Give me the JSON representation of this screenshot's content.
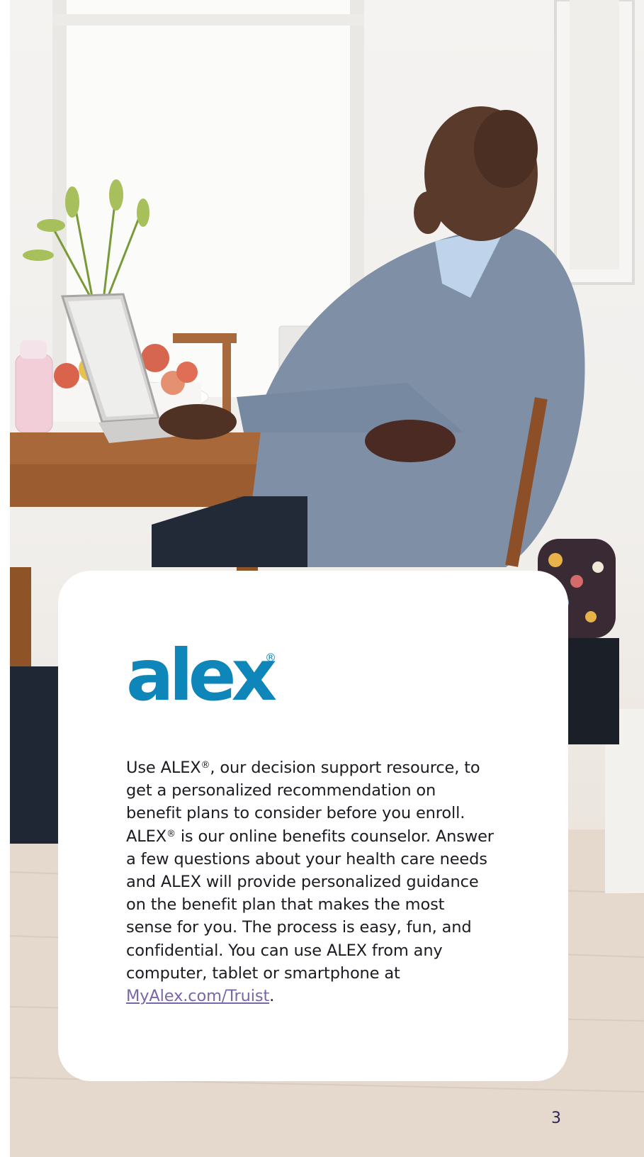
{
  "brand": {
    "logo_text": "alex",
    "logo_mark": "®",
    "logo_color": "#0f86b9"
  },
  "photo": {
    "icon": "man-at-laptop-photo"
  },
  "card": {
    "paragraph": {
      "part1": "Use ALEX",
      "reg1": "®",
      "part2": ", our decision support resource, to get a personalized recommendation on benefit plans to consider before you enroll. ALEX",
      "reg2": "®",
      "part3": " is our online benefits counselor. Answer a few questions about your health care needs and ALEX will provide personalized guidance on the benefit plan that makes the most sense for you. The process is easy, fun, and confidential. You can use ALEX from any computer, tablet or smartphone at ",
      "link_text": "MyAlex.com/Truist",
      "part4": "."
    }
  },
  "footer": {
    "page_number": "3"
  },
  "colors": {
    "text": "#1c1b22",
    "link": "#7a67a8",
    "page_number": "#2e2752"
  }
}
